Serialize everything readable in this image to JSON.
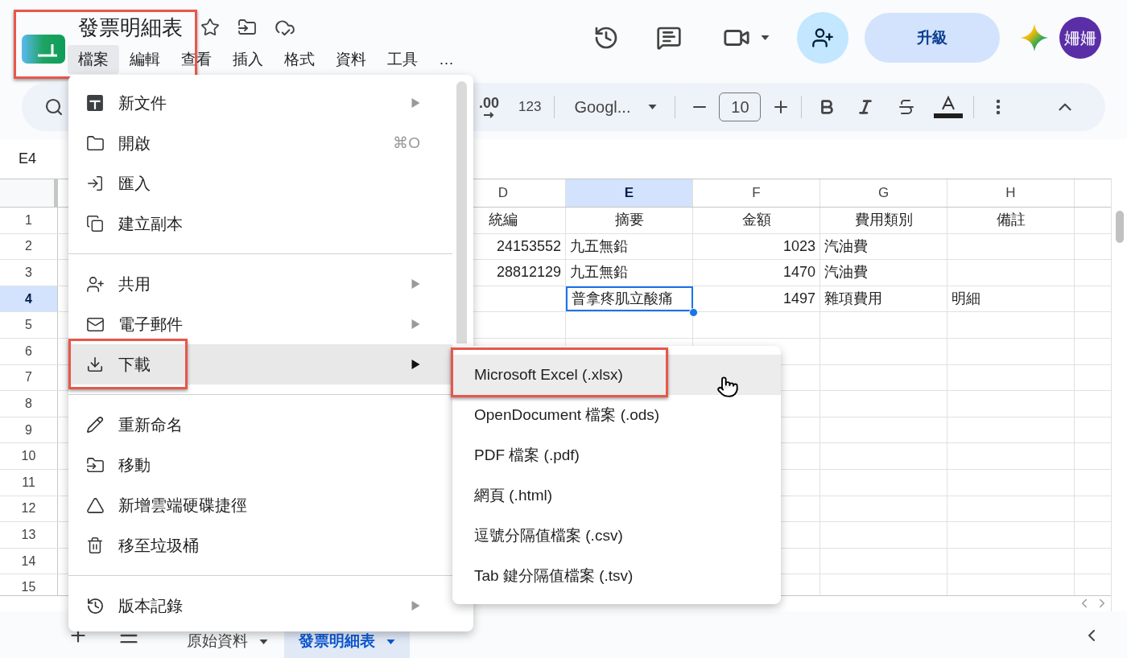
{
  "document": {
    "title": "發票明細表",
    "annotated": true
  },
  "menubar": [
    {
      "label": "檔案",
      "selected": true
    },
    {
      "label": "編輯",
      "selected": false
    },
    {
      "label": "查看",
      "selected": false
    },
    {
      "label": "插入",
      "selected": false
    },
    {
      "label": "格式",
      "selected": false
    },
    {
      "label": "資料",
      "selected": false
    },
    {
      "label": "工具",
      "selected": false
    },
    {
      "label": "…",
      "selected": false
    }
  ],
  "header_actions": {
    "upgrade": "升級",
    "avatar": "姍姍"
  },
  "toolbar": {
    "decimal": ".00",
    "number_format": "123",
    "font": "Googl...",
    "font_size": "10"
  },
  "name_box": "E4",
  "grid": {
    "columns": [
      {
        "label": "D",
        "selected": false
      },
      {
        "label": "E",
        "selected": true
      },
      {
        "label": "F",
        "selected": false
      },
      {
        "label": "G",
        "selected": false
      },
      {
        "label": "H",
        "selected": false
      }
    ],
    "rows": [
      {
        "label": "1",
        "selected": false,
        "cells": [
          {
            "text": "統編",
            "kind": "header",
            "selected": false
          },
          {
            "text": "摘要",
            "kind": "header",
            "selected": false
          },
          {
            "text": "金額",
            "kind": "header",
            "selected": false
          },
          {
            "text": "費用類別",
            "kind": "header",
            "selected": false
          },
          {
            "text": "備註",
            "kind": "header",
            "selected": false
          }
        ]
      },
      {
        "label": "2",
        "selected": false,
        "cells": [
          {
            "text": "24153552",
            "kind": "number",
            "selected": false
          },
          {
            "text": "九五無鉛",
            "kind": "text",
            "selected": false
          },
          {
            "text": "1023",
            "kind": "number",
            "selected": false
          },
          {
            "text": "汽油費",
            "kind": "text",
            "selected": false
          },
          null
        ]
      },
      {
        "label": "3",
        "selected": false,
        "cells": [
          {
            "text": "28812129",
            "kind": "number",
            "selected": false
          },
          {
            "text": "九五無鉛",
            "kind": "text",
            "selected": false
          },
          {
            "text": "1470",
            "kind": "number",
            "selected": false
          },
          {
            "text": "汽油費",
            "kind": "text",
            "selected": false
          },
          null
        ]
      },
      {
        "label": "4",
        "selected": true,
        "cells": [
          null,
          {
            "text": "普拿疼肌立酸痛",
            "kind": "text",
            "selected": true
          },
          {
            "text": "1497",
            "kind": "number",
            "selected": false
          },
          {
            "text": "雜項費用",
            "kind": "text",
            "selected": false
          },
          {
            "text": "明細",
            "kind": "text",
            "selected": false
          }
        ]
      },
      {
        "label": "5",
        "selected": false
      },
      {
        "label": "6",
        "selected": false
      },
      {
        "label": "7",
        "selected": false
      },
      {
        "label": "8",
        "selected": false
      },
      {
        "label": "9",
        "selected": false
      },
      {
        "label": "10",
        "selected": false
      },
      {
        "label": "11",
        "selected": false
      },
      {
        "label": "12",
        "selected": false
      },
      {
        "label": "13",
        "selected": false
      },
      {
        "label": "14",
        "selected": false
      },
      {
        "label": "15",
        "selected": false
      }
    ]
  },
  "file_menu": {
    "items": [
      {
        "kind": "item",
        "label": "新文件",
        "submenu": true,
        "selected": false,
        "annotated": false
      },
      {
        "kind": "item",
        "label": "開啟",
        "shortcut": "⌘O",
        "submenu": false,
        "selected": false,
        "annotated": false
      },
      {
        "kind": "item",
        "label": "匯入",
        "submenu": false,
        "selected": false,
        "annotated": false
      },
      {
        "kind": "item",
        "label": "建立副本",
        "submenu": false,
        "selected": false,
        "annotated": false
      },
      {
        "kind": "divider"
      },
      {
        "kind": "item",
        "label": "共用",
        "submenu": true,
        "selected": false,
        "annotated": false
      },
      {
        "kind": "item",
        "label": "電子郵件",
        "submenu": true,
        "selected": false,
        "annotated": false
      },
      {
        "kind": "item",
        "label": "下載",
        "submenu": true,
        "selected": true,
        "annotated": true
      },
      {
        "kind": "divider"
      },
      {
        "kind": "item",
        "label": "重新命名",
        "submenu": false,
        "selected": false,
        "annotated": false
      },
      {
        "kind": "item",
        "label": "移動",
        "submenu": false,
        "selected": false,
        "annotated": false
      },
      {
        "kind": "item",
        "label": "新增雲端硬碟捷徑",
        "submenu": false,
        "selected": false,
        "annotated": false
      },
      {
        "kind": "item",
        "label": "移至垃圾桶",
        "submenu": false,
        "selected": false,
        "annotated": false
      },
      {
        "kind": "divider"
      },
      {
        "kind": "item",
        "label": "版本記錄",
        "submenu": true,
        "selected": false,
        "annotated": false
      }
    ]
  },
  "download_submenu": {
    "items": [
      {
        "label": "Microsoft Excel (.xlsx)",
        "selected": true,
        "annotated": true
      },
      {
        "label": "OpenDocument 檔案 (.ods)",
        "selected": false,
        "annotated": false
      },
      {
        "label": "PDF 檔案 (.pdf)",
        "selected": false,
        "annotated": false
      },
      {
        "label": "網頁 (.html)",
        "selected": false,
        "annotated": false
      },
      {
        "label": "逗號分隔值檔案 (.csv)",
        "selected": false,
        "annotated": false
      },
      {
        "label": "Tab 鍵分隔值檔案 (.tsv)",
        "selected": false,
        "annotated": false
      }
    ]
  },
  "sheet_tabs": [
    {
      "label": "原始資料",
      "selected": false
    },
    {
      "label": "發票明細表",
      "selected": true
    }
  ]
}
